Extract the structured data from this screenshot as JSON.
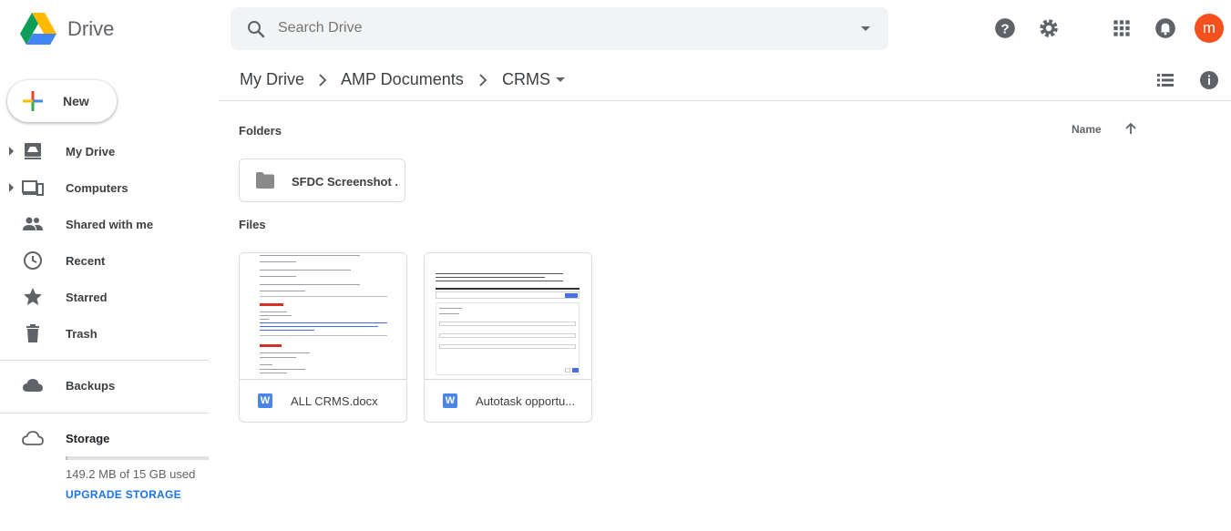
{
  "app": {
    "name": "Drive"
  },
  "search": {
    "placeholder": "Search Drive"
  },
  "header": {
    "avatar_letter": "m"
  },
  "sidebar": {
    "new_label": "New",
    "items": [
      {
        "label": "My Drive",
        "icon": "my-drive-icon",
        "expandable": true
      },
      {
        "label": "Computers",
        "icon": "computers-icon",
        "expandable": true
      },
      {
        "label": "Shared with me",
        "icon": "shared-icon",
        "expandable": false
      },
      {
        "label": "Recent",
        "icon": "clock-icon",
        "expandable": false
      },
      {
        "label": "Starred",
        "icon": "star-icon",
        "expandable": false
      },
      {
        "label": "Trash",
        "icon": "trash-icon",
        "expandable": false
      }
    ],
    "backups_label": "Backups",
    "storage_label": "Storage",
    "storage_used_text": "149.2 MB of 15 GB used",
    "storage_fraction": 0.01,
    "upgrade_label": "UPGRADE STORAGE"
  },
  "breadcrumb": [
    "My Drive",
    "AMP Documents",
    "CRMS"
  ],
  "sections": {
    "folders": "Folders",
    "files": "Files"
  },
  "sort": {
    "label": "Name",
    "direction": "ascending"
  },
  "folders": [
    {
      "name": "SFDC Screenshot ..."
    }
  ],
  "files": [
    {
      "name": "ALL CRMS.docx",
      "type": "W"
    },
    {
      "name": "Autotask opportu...",
      "type": "W"
    }
  ],
  "colors": {
    "accent": "#1a73e8",
    "avatar": "#f4511e",
    "word": "#4a86e8"
  }
}
